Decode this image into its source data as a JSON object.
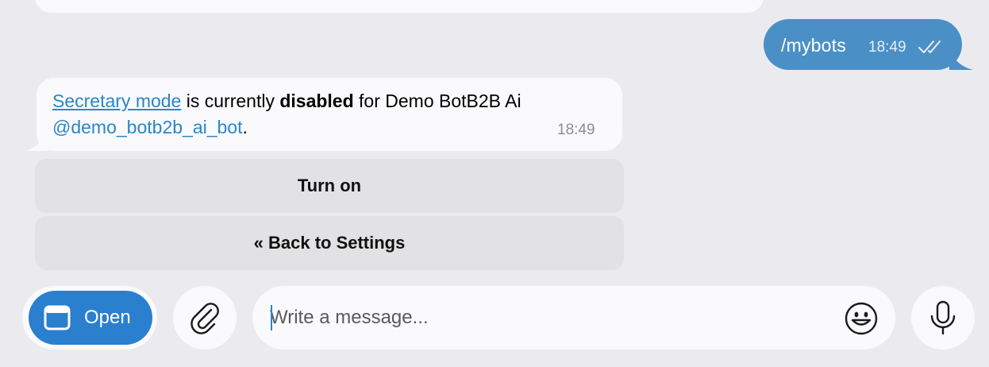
{
  "outgoing": {
    "text": "/mybots",
    "time": "18:49"
  },
  "incoming": {
    "link_text": "Secretary mode",
    "text_middle": " is currently ",
    "bold_text": "disabled",
    "text_after": " for Demo BotB2B Ai",
    "bot_username": "@demo_botb2b_ai_bot",
    "period": ".",
    "time": "18:49"
  },
  "keyboard": {
    "turn_on_label": "Turn on",
    "back_label": "« Back to Settings"
  },
  "composer": {
    "open_label": "Open",
    "placeholder": "Write a message...",
    "value": ""
  },
  "colors": {
    "outgoing_bubble": "#4b8fc7",
    "open_button": "#2a7fcf",
    "link": "#2a86c6"
  },
  "icons": {
    "read_receipt": "double-check-icon",
    "open": "window-icon",
    "attach": "paperclip-icon",
    "emoji": "smiley-icon",
    "mic": "microphone-icon"
  }
}
